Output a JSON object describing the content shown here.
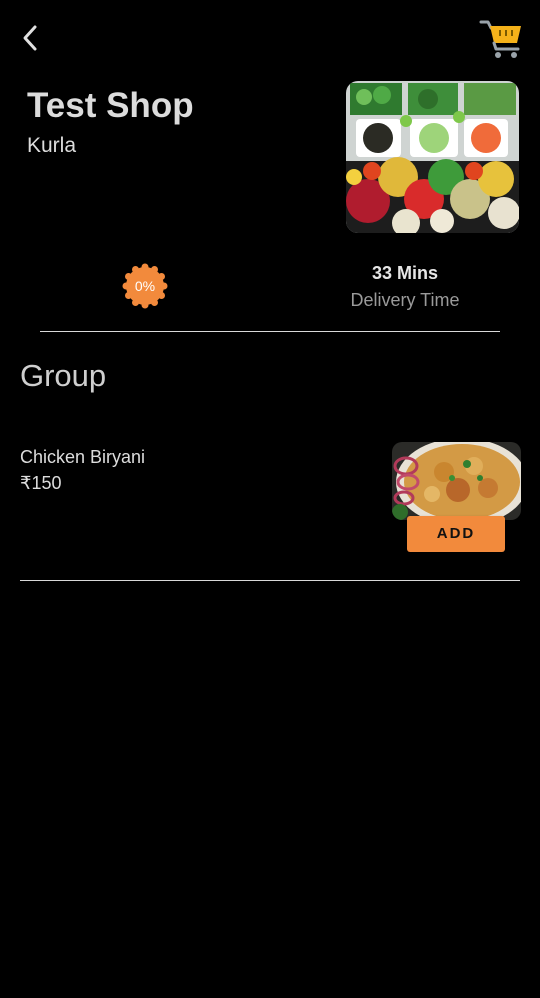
{
  "shop": {
    "name": "Test Shop",
    "location": "Kurla"
  },
  "discount": {
    "label": "0%",
    "color": "#f28a3c"
  },
  "delivery": {
    "time": "33 Mins",
    "label": "Delivery Time"
  },
  "menu": {
    "group_title": "Group",
    "items": [
      {
        "name": "Chicken Biryani",
        "price": "₹150",
        "add_label": "ADD"
      }
    ]
  },
  "icons": {
    "back": "back-arrow-icon",
    "cart": "shopping-cart-icon"
  },
  "colors": {
    "background": "#000000",
    "accent": "#f28a3c",
    "cart_yellow": "#f5b21a",
    "cart_gray": "#9aa3aa"
  }
}
